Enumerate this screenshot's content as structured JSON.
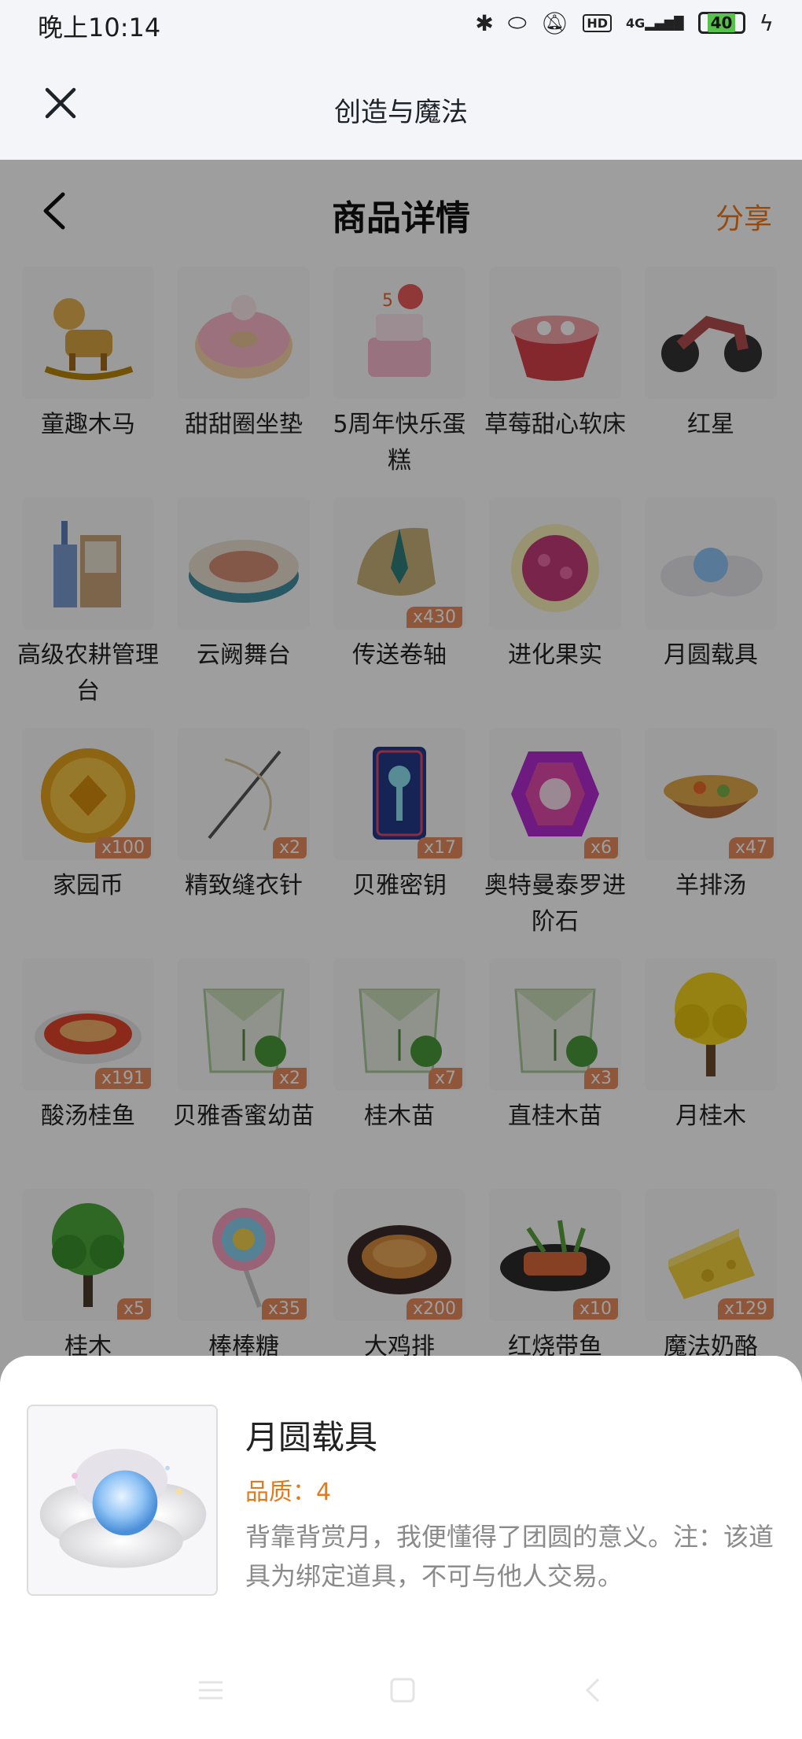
{
  "status_bar": {
    "time": "晚上10:14",
    "signal": "4G",
    "hd": "HD",
    "battery": "40"
  },
  "mini_program": {
    "title": "创造与魔法"
  },
  "nav": {
    "title": "商品详情",
    "share": "分享"
  },
  "items": [
    {
      "name": "童趣木马",
      "count": "",
      "icon": "rocking-horse-icon"
    },
    {
      "name": "甜甜圈坐垫",
      "count": "",
      "icon": "donut-cushion-icon"
    },
    {
      "name": "5周年快乐蛋糕",
      "count": "",
      "icon": "birthday-cake-icon"
    },
    {
      "name": "草莓甜心软床",
      "count": "",
      "icon": "strawberry-bed-icon"
    },
    {
      "name": "红星",
      "count": "",
      "icon": "motorcycle-icon"
    },
    {
      "name": "高级农耕管理台",
      "count": "",
      "icon": "farm-console-icon"
    },
    {
      "name": "云阙舞台",
      "count": "",
      "icon": "stage-icon"
    },
    {
      "name": "传送卷轴",
      "count": "x430",
      "icon": "scroll-icon"
    },
    {
      "name": "进化果实",
      "count": "",
      "icon": "evolution-fruit-icon"
    },
    {
      "name": "月圆载具",
      "count": "",
      "icon": "moon-vehicle-icon"
    },
    {
      "name": "家园币",
      "count": "x100",
      "icon": "coin-icon"
    },
    {
      "name": "精致缝衣针",
      "count": "x2",
      "icon": "needle-icon"
    },
    {
      "name": "贝雅密钥",
      "count": "x17",
      "icon": "key-card-icon"
    },
    {
      "name": "奥特曼泰罗进阶石",
      "count": "x6",
      "icon": "gem-stone-icon"
    },
    {
      "name": "羊排汤",
      "count": "x47",
      "icon": "soup-bowl-icon"
    },
    {
      "name": "酸汤桂鱼",
      "count": "x191",
      "icon": "fish-dish-icon"
    },
    {
      "name": "贝雅香蜜幼苗",
      "count": "x2",
      "icon": "seed-pack-icon"
    },
    {
      "name": "桂木苗",
      "count": "x7",
      "icon": "seed-pack-icon"
    },
    {
      "name": "直桂木苗",
      "count": "x3",
      "icon": "seed-pack-icon"
    },
    {
      "name": "月桂木",
      "count": "",
      "icon": "yellow-tree-icon"
    },
    {
      "name": "桂木",
      "count": "x5",
      "icon": "green-tree-icon"
    },
    {
      "name": "棒棒糖",
      "count": "x35",
      "icon": "lollipop-icon"
    },
    {
      "name": "大鸡排",
      "count": "x200",
      "icon": "chicken-cutlet-icon"
    },
    {
      "name": "红烧带鱼",
      "count": "x10",
      "icon": "braised-fish-icon"
    },
    {
      "name": "魔法奶酪",
      "count": "x129",
      "icon": "cheese-icon"
    }
  ],
  "detail": {
    "name": "月圆载具",
    "quality": "品质：4",
    "description": "背靠背赏月，我便懂得了团圆的意义。注：该道具为绑定道具，不可与他人交易。",
    "icon": "moon-vehicle-icon"
  }
}
